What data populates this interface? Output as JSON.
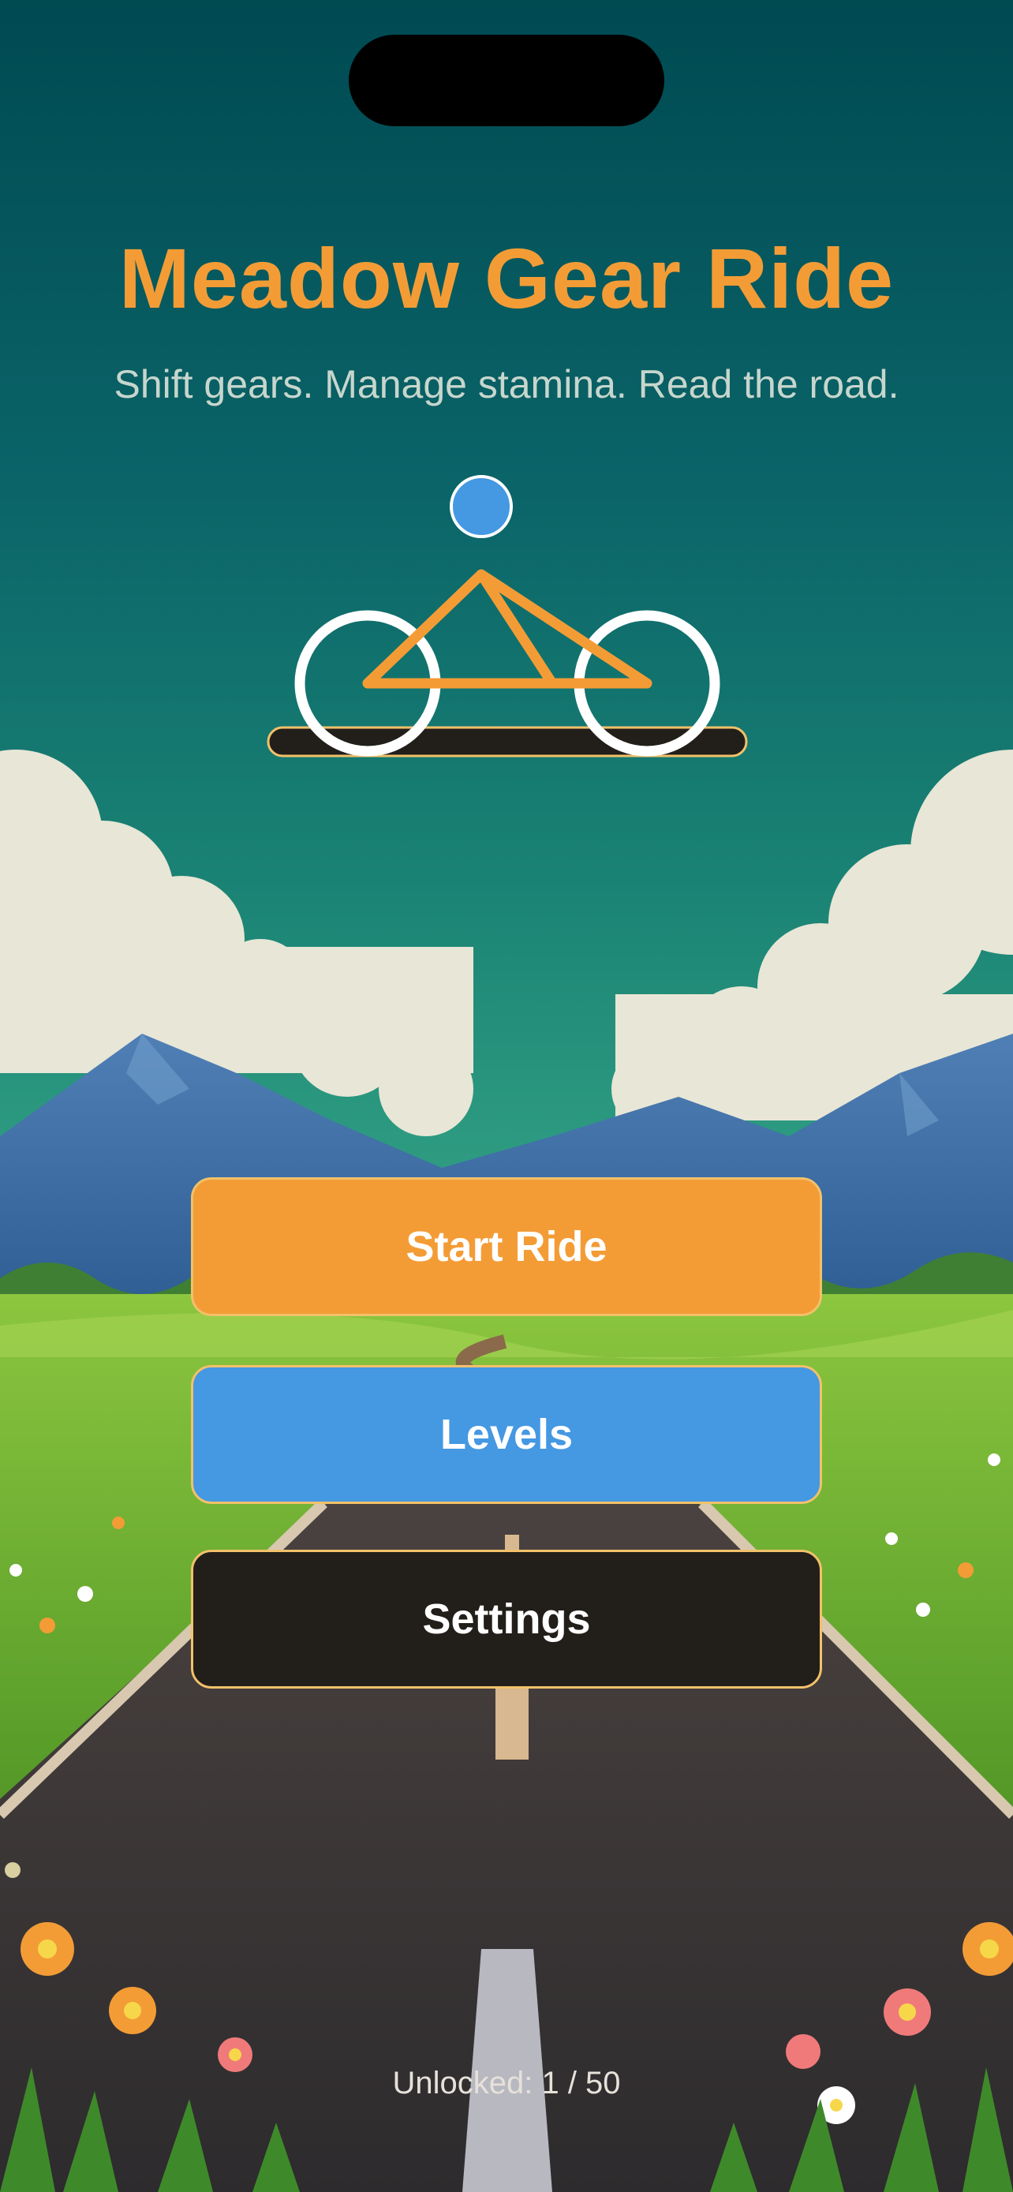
{
  "game": {
    "title": "Meadow Gear Ride",
    "subtitle": "Shift gears. Manage stamina. Read the road."
  },
  "menu": {
    "start_label": "Start Ride",
    "levels_label": "Levels",
    "settings_label": "Settings"
  },
  "progress": {
    "unlocked_text": "Unlocked: 1 / 50",
    "unlocked": 1,
    "total": 50
  },
  "colors": {
    "accent": "#f39c36",
    "secondary": "#4598e2",
    "dark": "#221f1a",
    "button_border": "#f2c16a"
  },
  "icons": {
    "logo": "bicycle-icon"
  }
}
